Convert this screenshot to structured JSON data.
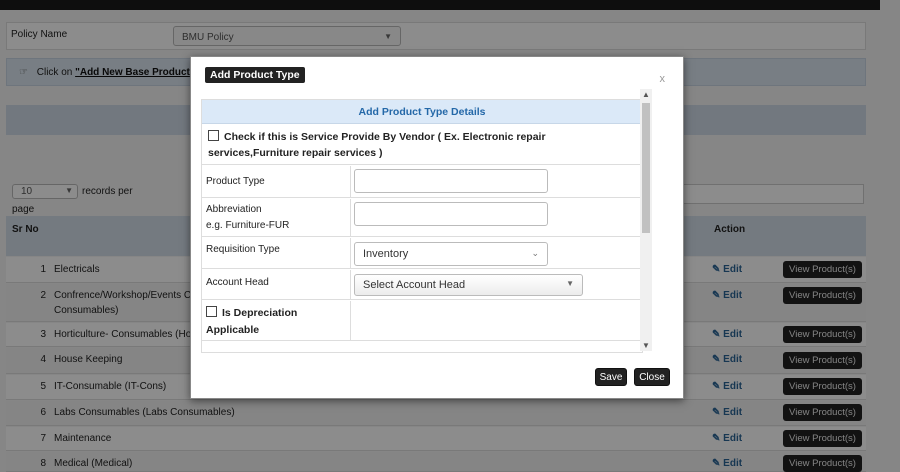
{
  "background": {
    "policy_label": "Policy Name",
    "policy_value": "BMU Policy",
    "info_prefix": "Click on",
    "info_link": "\"Add New Base Product",
    "records_value": "10",
    "records_text": "records per",
    "page_text": "page",
    "header_sr": "Sr No",
    "header_action": "Action",
    "edit_label": "Edit",
    "view_label": "View Product(s)",
    "rows": [
      {
        "no": "1",
        "name": "Electricals"
      },
      {
        "no": "2",
        "name": "Confrence/Workshop/Events Co",
        "name2": "Consumables)"
      },
      {
        "no": "3",
        "name": "Horticulture- Consumables (Hort"
      },
      {
        "no": "4",
        "name": "House Keeping"
      },
      {
        "no": "5",
        "name": "IT-Consumable (IT-Cons)"
      },
      {
        "no": "6",
        "name": "Labs Consumables (Labs Consumables)"
      },
      {
        "no": "7",
        "name": "Maintenance"
      },
      {
        "no": "8",
        "name": "Medical (Medical)"
      }
    ]
  },
  "modal": {
    "title": "Add Product Type",
    "close": "x",
    "form_title": "Add Product Type Details",
    "vendor_text": "Check if this is Service Provide By Vendor ( Ex. Electronic repair services,Furniture repair services )",
    "product_type_label": "Product Type",
    "abbreviation_label": "Abbreviation",
    "abbreviation_hint": "e.g. Furniture-FUR",
    "requisition_label": "Requisition Type",
    "requisition_value": "Inventory",
    "account_head_label": "Account Head",
    "account_head_value": "Select Account Head",
    "depreciation_label": "Is Depreciation",
    "depreciation_label2": "Applicable",
    "save_label": "Save",
    "close_label": "Close"
  }
}
